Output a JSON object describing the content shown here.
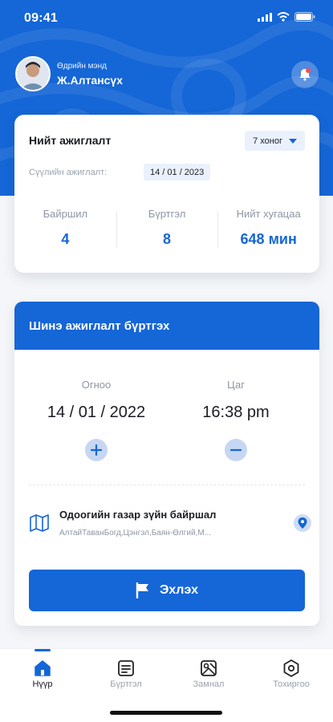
{
  "status": {
    "time": "09:41"
  },
  "profile": {
    "greeting": "Өдрийн мэнд",
    "name": "Ж.Алтансүх"
  },
  "summary": {
    "title": "Нийт ажиглалт",
    "range": "7 хоног",
    "last_label": "Сүүлийн ажиглалт:",
    "last_value": "14 / 01 / 2023",
    "stats": [
      {
        "label": "Байршил",
        "value": "4"
      },
      {
        "label": "Бүртгэл",
        "value": "8"
      },
      {
        "label": "Нийт хугацаа",
        "value": "648 мин"
      }
    ]
  },
  "new_obs": {
    "title": "Шинэ ажиглалт бүртгэх",
    "date_label": "Огноо",
    "date_value": "14 / 01 / 2022",
    "time_label": "Цаг",
    "time_value": "16:38 pm",
    "location_title": "Одоогийн газар зүйн байршал",
    "location_address": "АлтайТаванБогд,Цэнгэл,Баян-Өлгий,М...",
    "start_label": "Эхлэх"
  },
  "tabs": [
    {
      "label": "Нүүр",
      "icon": "home-icon",
      "active": true
    },
    {
      "label": "Бүртгэл",
      "icon": "list-icon",
      "active": false
    },
    {
      "label": "Замнал",
      "icon": "route-map-icon",
      "active": false
    },
    {
      "label": "Тохиргоо",
      "icon": "settings-icon",
      "active": false
    }
  ],
  "colors": {
    "primary": "#1566d6",
    "soft": "#c7d7f3",
    "notification": "#ff4d4d"
  }
}
